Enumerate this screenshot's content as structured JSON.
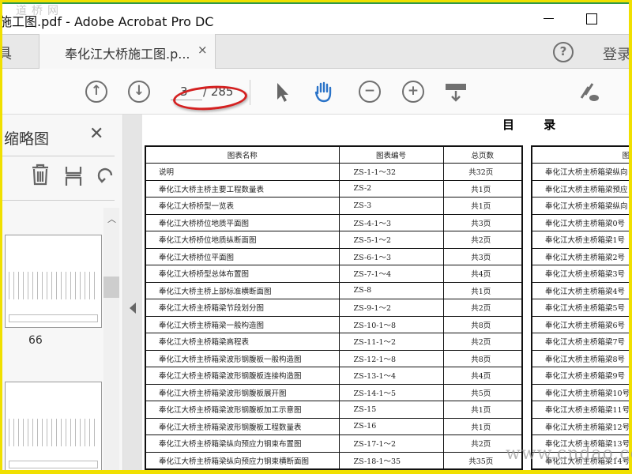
{
  "window": {
    "title": "施工图.pdf - Adobe Acrobat Pro DC",
    "watermark_top": "道桥网",
    "watermark_bottom": "www.cndao.com"
  },
  "tabs": {
    "tools": "具",
    "doc": "奉化江大桥施工图.p...",
    "close": "×",
    "login": "登录",
    "help": "?"
  },
  "toolbar": {
    "page_current": "3",
    "page_total": "/ 285"
  },
  "panel": {
    "title": "缩略图",
    "close": "✕",
    "thumb_label": "66"
  },
  "document": {
    "title": "目 录",
    "headers": [
      "图表名称",
      "图表编号",
      "总页数"
    ],
    "rows": [
      [
        "说明",
        "ZS-1-1～32",
        "共32页"
      ],
      [
        "奉化江大桥主桥主要工程数量表",
        "ZS-2",
        "共1页"
      ],
      [
        "奉化江大桥桥型一览表",
        "ZS-3",
        "共1页"
      ],
      [
        "奉化江大桥桥位地质平面图",
        "ZS-4-1～3",
        "共3页"
      ],
      [
        "奉化江大桥桥位地质纵断面图",
        "ZS-5-1～2",
        "共2页"
      ],
      [
        "奉化江大桥桥位平面图",
        "ZS-6-1～3",
        "共3页"
      ],
      [
        "奉化江大桥桥型总体布置图",
        "ZS-7-1～4",
        "共4页"
      ],
      [
        "奉化江大桥主桥上部标准横断面图",
        "ZS-8",
        "共1页"
      ],
      [
        "奉化江大桥主桥箱梁节段划分图",
        "ZS-9-1～2",
        "共2页"
      ],
      [
        "奉化江大桥主桥箱梁一般构造图",
        "ZS-10-1～8",
        "共8页"
      ],
      [
        "奉化江大桥主桥箱梁高程表",
        "ZS-11-1～2",
        "共2页"
      ],
      [
        "奉化江大桥主桥箱梁波形钢腹板一般构造图",
        "ZS-12-1～8",
        "共8页"
      ],
      [
        "奉化江大桥主桥箱梁波形钢腹板连接构造图",
        "ZS-13-1～4",
        "共4页"
      ],
      [
        "奉化江大桥主桥箱梁波形钢腹板展开图",
        "ZS-14-1～5",
        "共5页"
      ],
      [
        "奉化江大桥主桥箱梁波形钢腹板加工示意图",
        "ZS-15",
        "共1页"
      ],
      [
        "奉化江大桥主桥箱梁波形钢腹板工程数量表",
        "ZS-16",
        "共1页"
      ],
      [
        "奉化江大桥主桥箱梁纵向预应力钢束布置图",
        "ZS-17-1～2",
        "共2页"
      ],
      [
        "奉化江大桥主桥箱梁纵向预应力钢束横断面图",
        "ZS-18-1～35",
        "共35页"
      ]
    ],
    "right_header": "图",
    "right_rows": [
      "奉化江大桥主桥箱梁纵向",
      "奉化江大桥主桥箱梁预应",
      "奉化江大桥主桥箱梁纵向",
      "奉化江大桥主桥箱梁0号",
      "奉化江大桥主桥箱梁1号",
      "奉化江大桥主桥箱梁2号",
      "奉化江大桥主桥箱梁3号",
      "奉化江大桥主桥箱梁4号",
      "奉化江大桥主桥箱梁5号",
      "奉化江大桥主桥箱梁6号",
      "奉化江大桥主桥箱梁7号",
      "奉化江大桥主桥箱梁8号",
      "奉化江大桥主桥箱梁9号",
      "奉化江大桥主桥箱梁10号",
      "奉化江大桥主桥箱梁11号",
      "奉化江大桥主桥箱梁12号",
      "奉化江大桥主桥箱梁13号",
      "奉化江大桥主桥箱梁14号"
    ]
  }
}
